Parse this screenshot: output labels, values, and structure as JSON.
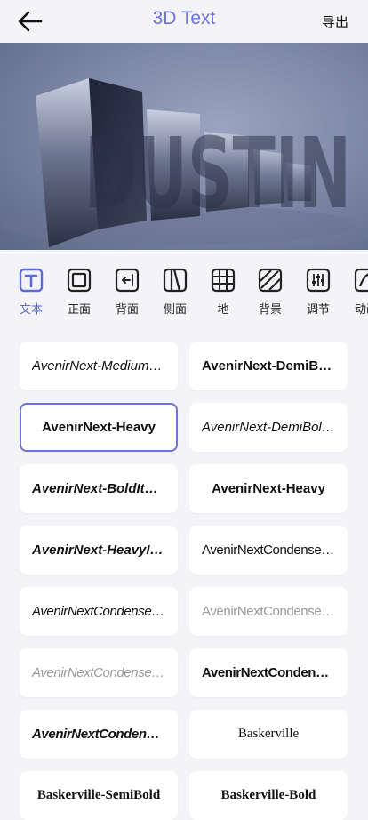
{
  "header": {
    "title": "3D Text",
    "export_label": "导出"
  },
  "preview": {
    "text": "DUSTIN"
  },
  "tools": [
    {
      "label": "文本",
      "icon": "text-icon"
    },
    {
      "label": "正面",
      "icon": "front-icon"
    },
    {
      "label": "背面",
      "icon": "back-face-icon"
    },
    {
      "label": "侧面",
      "icon": "side-icon"
    },
    {
      "label": "地",
      "icon": "grid-icon"
    },
    {
      "label": "背景",
      "icon": "background-icon"
    },
    {
      "label": "调节",
      "icon": "sliders-icon"
    },
    {
      "label": "动画",
      "icon": "animation-icon"
    }
  ],
  "fonts": [
    "AvenirNext-MediumItalic",
    "AvenirNext-DemiBold",
    "AvenirNext-Heavy",
    "AvenirNext-DemiBoldItalic",
    "AvenirNext-BoldItalic",
    "AvenirNext-Heavy",
    "AvenirNext-HeavyItalic",
    "AvenirNextCondensed-Regular",
    "AvenirNextCondensed-Italic",
    "AvenirNextCondensed-UltraLight",
    "AvenirNextCondensed-UltraLightItalic",
    "AvenirNextCondensed-DemiBold",
    "AvenirNextCondensed-HeavyItalic",
    "Baskerville",
    "Baskerville-SemiBold",
    "Baskerville-Bold"
  ],
  "colors": {
    "accent": "#6b73e0"
  }
}
